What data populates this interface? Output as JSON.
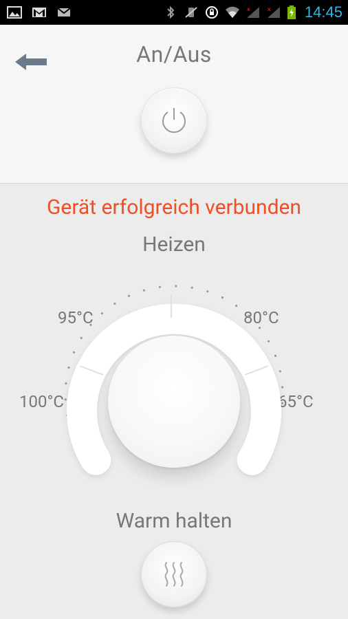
{
  "status_bar": {
    "time": "14:45",
    "left_icons": [
      "gallery-icon",
      "gmail-icon",
      "email-icon"
    ],
    "right_icons": [
      "bluetooth-icon",
      "vibrate-icon",
      "rotation-lock-icon",
      "wifi-icon",
      "signal-1-icon",
      "signal-2-icon",
      "battery-charging-icon"
    ],
    "time_color": "#33b5e5"
  },
  "header": {
    "title": "An/Aus",
    "back_icon": "back-arrow-icon",
    "power_icon": "power-icon"
  },
  "main": {
    "status_message": "Gerät erfolgreich verbunden",
    "status_color": "#f04e23",
    "mode_label": "Heizen",
    "temperatures": {
      "t95": "95°C",
      "t80": "80°C",
      "t100": "100°C",
      "t65": "65°C"
    },
    "warm_label": "Warm halten",
    "warm_icon": "steam-icon"
  }
}
